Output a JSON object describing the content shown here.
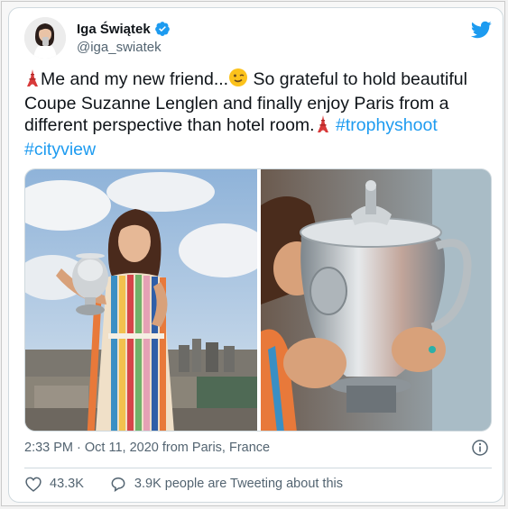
{
  "author": {
    "display_name": "Iga Świątek",
    "handle": "@iga_swiatek",
    "verified": true,
    "avatar_icon": "profile-photo"
  },
  "tweet": {
    "line1_before_emoji": "Me and my new friend...",
    "line1_after_emoji": " So grateful to hold beautiful",
    "line2": "Coupe Suzanne Lenglen and finally enjoy Paris from a",
    "line3": "different perspective than hotel room.",
    "hashtag1": "#trophyshoot",
    "hashtag2": "#cityview",
    "emojis": [
      "eiffel-tower",
      "winking-face",
      "eiffel-tower"
    ]
  },
  "media": {
    "photos": [
      "photo-iga-with-trophy-paris-rooftop",
      "photo-iga-kissing-trophy"
    ]
  },
  "meta": {
    "timestamp": "2:33 PM · Oct 11, 2020 from Paris, France"
  },
  "engagement": {
    "likes": "43.3K",
    "tweeting_about": "3.9K people are Tweeting about this"
  },
  "colors": {
    "link": "#1d9bf0",
    "verified": "#1d9bf0",
    "text": "#0f1419",
    "secondary": "#536471"
  }
}
